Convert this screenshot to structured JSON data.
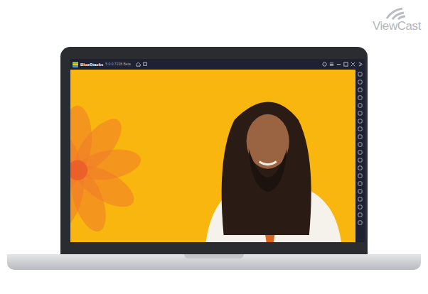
{
  "logo": {
    "text": "ViewCast"
  },
  "window": {
    "title": "BlueStacks",
    "version": "5.0.0.7228 Beta"
  }
}
